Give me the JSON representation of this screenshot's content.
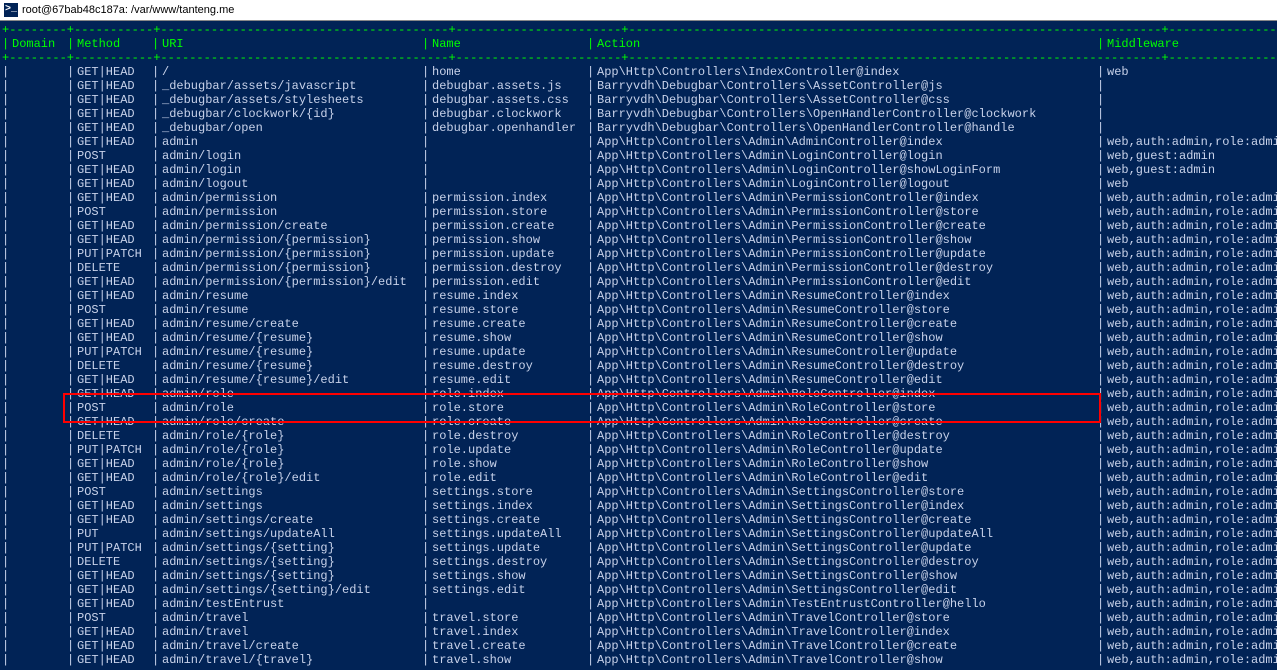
{
  "window_title": "root@67bab48c187a: /var/www/tanteng.me",
  "headers": {
    "domain": "Domain",
    "method": "Method",
    "uri": "URI",
    "name": "Name",
    "action": "Action",
    "middleware": "Middleware"
  },
  "highlight_index": 24,
  "rows": [
    {
      "method": "GET|HEAD",
      "uri": "/",
      "name": "home",
      "action": "App\\Http\\Controllers\\IndexController@index",
      "middleware": "web"
    },
    {
      "method": "GET|HEAD",
      "uri": "_debugbar/assets/javascript",
      "name": "debugbar.assets.js",
      "action": "Barryvdh\\Debugbar\\Controllers\\AssetController@js",
      "middleware": ""
    },
    {
      "method": "GET|HEAD",
      "uri": "_debugbar/assets/stylesheets",
      "name": "debugbar.assets.css",
      "action": "Barryvdh\\Debugbar\\Controllers\\AssetController@css",
      "middleware": ""
    },
    {
      "method": "GET|HEAD",
      "uri": "_debugbar/clockwork/{id}",
      "name": "debugbar.clockwork",
      "action": "Barryvdh\\Debugbar\\Controllers\\OpenHandlerController@clockwork",
      "middleware": ""
    },
    {
      "method": "GET|HEAD",
      "uri": "_debugbar/open",
      "name": "debugbar.openhandler",
      "action": "Barryvdh\\Debugbar\\Controllers\\OpenHandlerController@handle",
      "middleware": ""
    },
    {
      "method": "GET|HEAD",
      "uri": "admin",
      "name": "",
      "action": "App\\Http\\Controllers\\Admin\\AdminController@index",
      "middleware": "web,auth:admin,role:admin"
    },
    {
      "method": "POST",
      "uri": "admin/login",
      "name": "",
      "action": "App\\Http\\Controllers\\Admin\\LoginController@login",
      "middleware": "web,guest:admin"
    },
    {
      "method": "GET|HEAD",
      "uri": "admin/login",
      "name": "",
      "action": "App\\Http\\Controllers\\Admin\\LoginController@showLoginForm",
      "middleware": "web,guest:admin"
    },
    {
      "method": "GET|HEAD",
      "uri": "admin/logout",
      "name": "",
      "action": "App\\Http\\Controllers\\Admin\\LoginController@logout",
      "middleware": "web"
    },
    {
      "method": "GET|HEAD",
      "uri": "admin/permission",
      "name": "permission.index",
      "action": "App\\Http\\Controllers\\Admin\\PermissionController@index",
      "middleware": "web,auth:admin,role:admin"
    },
    {
      "method": "POST",
      "uri": "admin/permission",
      "name": "permission.store",
      "action": "App\\Http\\Controllers\\Admin\\PermissionController@store",
      "middleware": "web,auth:admin,role:admin"
    },
    {
      "method": "GET|HEAD",
      "uri": "admin/permission/create",
      "name": "permission.create",
      "action": "App\\Http\\Controllers\\Admin\\PermissionController@create",
      "middleware": "web,auth:admin,role:admin"
    },
    {
      "method": "GET|HEAD",
      "uri": "admin/permission/{permission}",
      "name": "permission.show",
      "action": "App\\Http\\Controllers\\Admin\\PermissionController@show",
      "middleware": "web,auth:admin,role:admin"
    },
    {
      "method": "PUT|PATCH",
      "uri": "admin/permission/{permission}",
      "name": "permission.update",
      "action": "App\\Http\\Controllers\\Admin\\PermissionController@update",
      "middleware": "web,auth:admin,role:admin"
    },
    {
      "method": "DELETE",
      "uri": "admin/permission/{permission}",
      "name": "permission.destroy",
      "action": "App\\Http\\Controllers\\Admin\\PermissionController@destroy",
      "middleware": "web,auth:admin,role:admin"
    },
    {
      "method": "GET|HEAD",
      "uri": "admin/permission/{permission}/edit",
      "name": "permission.edit",
      "action": "App\\Http\\Controllers\\Admin\\PermissionController@edit",
      "middleware": "web,auth:admin,role:admin"
    },
    {
      "method": "GET|HEAD",
      "uri": "admin/resume",
      "name": "resume.index",
      "action": "App\\Http\\Controllers\\Admin\\ResumeController@index",
      "middleware": "web,auth:admin,role:admin"
    },
    {
      "method": "POST",
      "uri": "admin/resume",
      "name": "resume.store",
      "action": "App\\Http\\Controllers\\Admin\\ResumeController@store",
      "middleware": "web,auth:admin,role:admin"
    },
    {
      "method": "GET|HEAD",
      "uri": "admin/resume/create",
      "name": "resume.create",
      "action": "App\\Http\\Controllers\\Admin\\ResumeController@create",
      "middleware": "web,auth:admin,role:admin"
    },
    {
      "method": "GET|HEAD",
      "uri": "admin/resume/{resume}",
      "name": "resume.show",
      "action": "App\\Http\\Controllers\\Admin\\ResumeController@show",
      "middleware": "web,auth:admin,role:admin"
    },
    {
      "method": "PUT|PATCH",
      "uri": "admin/resume/{resume}",
      "name": "resume.update",
      "action": "App\\Http\\Controllers\\Admin\\ResumeController@update",
      "middleware": "web,auth:admin,role:admin"
    },
    {
      "method": "DELETE",
      "uri": "admin/resume/{resume}",
      "name": "resume.destroy",
      "action": "App\\Http\\Controllers\\Admin\\ResumeController@destroy",
      "middleware": "web,auth:admin,role:admin"
    },
    {
      "method": "GET|HEAD",
      "uri": "admin/resume/{resume}/edit",
      "name": "resume.edit",
      "action": "App\\Http\\Controllers\\Admin\\ResumeController@edit",
      "middleware": "web,auth:admin,role:admin"
    },
    {
      "method": "GET|HEAD",
      "uri": "admin/role",
      "name": "role.index",
      "action": "App\\Http\\Controllers\\Admin\\RoleController@index",
      "middleware": "web,auth:admin,role:admin"
    },
    {
      "method": "POST",
      "uri": "admin/role",
      "name": "role.store",
      "action": "App\\Http\\Controllers\\Admin\\RoleController@store",
      "middleware": "web,auth:admin,role:admin"
    },
    {
      "method": "GET|HEAD",
      "uri": "admin/role/create",
      "name": "role.create",
      "action": "App\\Http\\Controllers\\Admin\\RoleController@create",
      "middleware": "web,auth:admin,role:admin"
    },
    {
      "method": "DELETE",
      "uri": "admin/role/{role}",
      "name": "role.destroy",
      "action": "App\\Http\\Controllers\\Admin\\RoleController@destroy",
      "middleware": "web,auth:admin,role:admin"
    },
    {
      "method": "PUT|PATCH",
      "uri": "admin/role/{role}",
      "name": "role.update",
      "action": "App\\Http\\Controllers\\Admin\\RoleController@update",
      "middleware": "web,auth:admin,role:admin"
    },
    {
      "method": "GET|HEAD",
      "uri": "admin/role/{role}",
      "name": "role.show",
      "action": "App\\Http\\Controllers\\Admin\\RoleController@show",
      "middleware": "web,auth:admin,role:admin"
    },
    {
      "method": "GET|HEAD",
      "uri": "admin/role/{role}/edit",
      "name": "role.edit",
      "action": "App\\Http\\Controllers\\Admin\\RoleController@edit",
      "middleware": "web,auth:admin,role:admin"
    },
    {
      "method": "POST",
      "uri": "admin/settings",
      "name": "settings.store",
      "action": "App\\Http\\Controllers\\Admin\\SettingsController@store",
      "middleware": "web,auth:admin,role:admin"
    },
    {
      "method": "GET|HEAD",
      "uri": "admin/settings",
      "name": "settings.index",
      "action": "App\\Http\\Controllers\\Admin\\SettingsController@index",
      "middleware": "web,auth:admin,role:admin"
    },
    {
      "method": "GET|HEAD",
      "uri": "admin/settings/create",
      "name": "settings.create",
      "action": "App\\Http\\Controllers\\Admin\\SettingsController@create",
      "middleware": "web,auth:admin,role:admin"
    },
    {
      "method": "PUT",
      "uri": "admin/settings/updateAll",
      "name": "settings.updateAll",
      "action": "App\\Http\\Controllers\\Admin\\SettingsController@updateAll",
      "middleware": "web,auth:admin,role:admin"
    },
    {
      "method": "PUT|PATCH",
      "uri": "admin/settings/{setting}",
      "name": "settings.update",
      "action": "App\\Http\\Controllers\\Admin\\SettingsController@update",
      "middleware": "web,auth:admin,role:admin"
    },
    {
      "method": "DELETE",
      "uri": "admin/settings/{setting}",
      "name": "settings.destroy",
      "action": "App\\Http\\Controllers\\Admin\\SettingsController@destroy",
      "middleware": "web,auth:admin,role:admin"
    },
    {
      "method": "GET|HEAD",
      "uri": "admin/settings/{setting}",
      "name": "settings.show",
      "action": "App\\Http\\Controllers\\Admin\\SettingsController@show",
      "middleware": "web,auth:admin,role:admin"
    },
    {
      "method": "GET|HEAD",
      "uri": "admin/settings/{setting}/edit",
      "name": "settings.edit",
      "action": "App\\Http\\Controllers\\Admin\\SettingsController@edit",
      "middleware": "web,auth:admin,role:admin"
    },
    {
      "method": "GET|HEAD",
      "uri": "admin/testEntrust",
      "name": "",
      "action": "App\\Http\\Controllers\\Admin\\TestEntrustController@hello",
      "middleware": "web,auth:admin,role:admin"
    },
    {
      "method": "POST",
      "uri": "admin/travel",
      "name": "travel.store",
      "action": "App\\Http\\Controllers\\Admin\\TravelController@store",
      "middleware": "web,auth:admin,role:admin"
    },
    {
      "method": "GET|HEAD",
      "uri": "admin/travel",
      "name": "travel.index",
      "action": "App\\Http\\Controllers\\Admin\\TravelController@index",
      "middleware": "web,auth:admin,role:admin"
    },
    {
      "method": "GET|HEAD",
      "uri": "admin/travel/create",
      "name": "travel.create",
      "action": "App\\Http\\Controllers\\Admin\\TravelController@create",
      "middleware": "web,auth:admin,role:admin"
    },
    {
      "method": "GET|HEAD",
      "uri": "admin/travel/{travel}",
      "name": "travel.show",
      "action": "App\\Http\\Controllers\\Admin\\TravelController@show",
      "middleware": "web,auth:admin,role:admin"
    }
  ]
}
